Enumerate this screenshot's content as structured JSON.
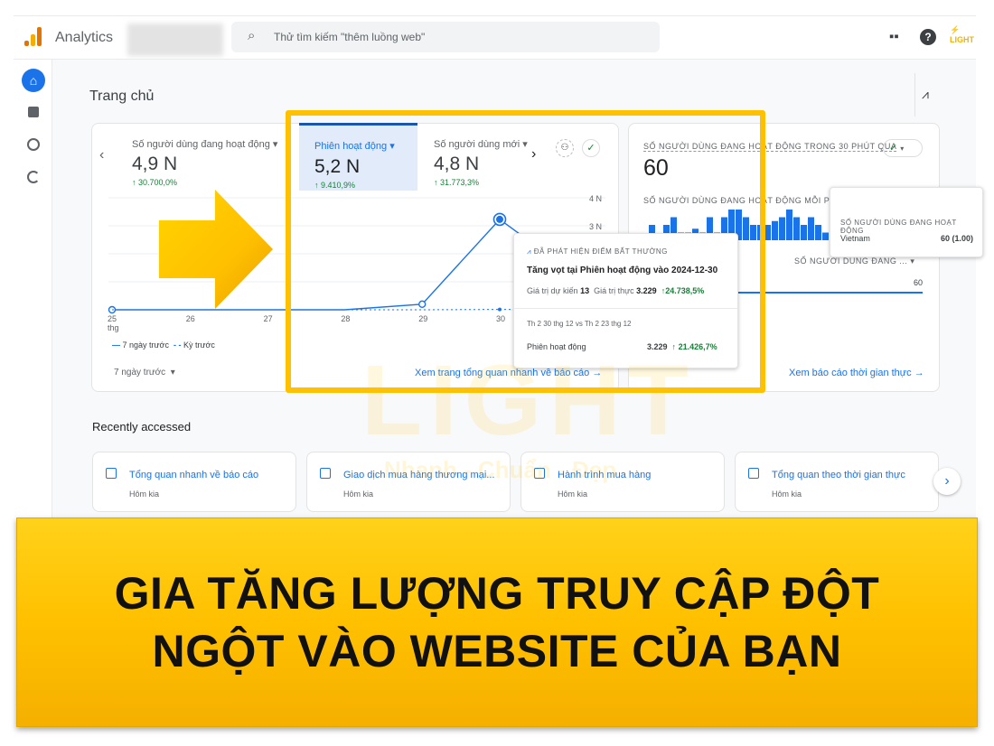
{
  "header": {
    "app_name": "Analytics",
    "search_placeholder": "Thử tìm kiếm \"thêm luồng web\"",
    "icons": [
      "apps-icon",
      "help-icon",
      "light-logo"
    ]
  },
  "sidebar": {
    "items": [
      "home-icon",
      "reports-icon",
      "explore-icon",
      "advertising-icon"
    ]
  },
  "page": {
    "title": "Trang chủ"
  },
  "metrics": [
    {
      "label": "Số người dùng đang hoạt động",
      "value": "4,9 N",
      "delta": "30.700,0%"
    },
    {
      "label": "Phiên hoạt động",
      "value": "5,2 N",
      "delta": "9.410,9%",
      "selected": true
    },
    {
      "label": "Số người dùng mới",
      "value": "4,8 N",
      "delta": "31.773,3%"
    }
  ],
  "chart_data": {
    "type": "line",
    "x": [
      "25 thg",
      "26",
      "27",
      "28",
      "29",
      "30"
    ],
    "series": [
      {
        "name": "7 ngày trước",
        "style": "solid",
        "values": [
          0,
          0,
          0,
          0,
          0.2,
          3.229
        ]
      },
      {
        "name": "Kỳ trước",
        "style": "dashed",
        "values": [
          0,
          0,
          0,
          0,
          0,
          0.013
        ]
      }
    ],
    "y_ticks": [
      "3 N",
      "4 N"
    ],
    "ylim": [
      0,
      4
    ],
    "color": "#1a73e8"
  },
  "chart_controls": {
    "legend": [
      "7 ngày trước",
      "Kỳ trước"
    ],
    "range": "7 ngày trước",
    "link": "Xem trang tổng quan nhanh về báo cáo"
  },
  "anomaly": {
    "header": "ĐÃ PHÁT HIỆN ĐIỂM BẤT THƯỜNG",
    "title": "Tăng vọt tại Phiên hoạt động vào 2024-12-30",
    "expected_label": "Giá trị dự kiến",
    "expected": "13",
    "actual_label": "Giá trị thực",
    "actual": "3.229",
    "actual_delta": "24.738,5%",
    "compare": "Th 2 30 thg 12 vs Th 2 23 thg 12",
    "metric": "Phiên hoạt động",
    "metric_value": "3.229",
    "metric_delta": "21.426,7%"
  },
  "realtime": {
    "title": "SỐ NGƯỜI DÙNG ĐANG HOẠT ĐỘNG TRONG 30 PHÚT QUA",
    "value": "60",
    "per_minute": "SỐ NGƯỜI DÙNG ĐANG HOẠT ĐỘNG MỖI PHÚT",
    "bars": [
      2,
      0,
      2,
      3,
      1,
      1,
      1.5,
      1,
      3,
      1,
      3,
      4,
      4,
      3,
      2,
      2,
      2,
      2.5,
      3,
      4,
      3,
      2,
      3,
      2,
      1
    ],
    "col_label": "SỐ NGƯỜI DÙNG ĐANG ...",
    "row_value": "60",
    "link": "Xem báo cáo thời gian thực",
    "popup_title": "SỐ NGƯỜI DÙNG ĐANG HOẠT ĐỘNG",
    "popup_country": "Vietnam",
    "popup_value": "60 (1.00)"
  },
  "recent": {
    "title": "Recently accessed",
    "items": [
      {
        "title": "Tổng quan nhanh về báo cáo",
        "sub": "Hôm kia"
      },
      {
        "title": "Giao dịch mua hàng thương mại...",
        "sub": "Hôm kia"
      },
      {
        "title": "Hành trình mua hàng",
        "sub": "Hôm kia"
      },
      {
        "title": "Tổng quan theo thời gian thực",
        "sub": "Hôm kia"
      }
    ]
  },
  "banner": {
    "line1": "GIA TĂNG LƯỢNG TRUY CẬP ĐỘT",
    "line2": "NGỘT VÀO WEBSITE CỦA BẠN"
  },
  "watermark": {
    "brand": "LIGHT",
    "slogan": "Nhanh - Chuẩn - Đẹp"
  }
}
